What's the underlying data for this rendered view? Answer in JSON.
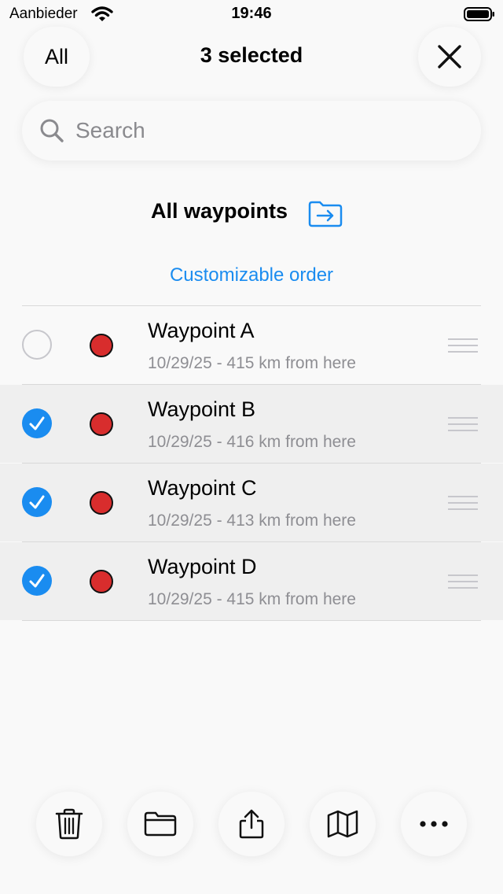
{
  "status_bar": {
    "carrier": "Aanbieder",
    "time": "19:46"
  },
  "nav": {
    "all_label": "All",
    "title": "3 selected"
  },
  "search": {
    "placeholder": "Search",
    "value": ""
  },
  "folder": {
    "title": "All waypoints",
    "order_label": "Customizable order"
  },
  "waypoints": [
    {
      "name": "Waypoint A",
      "subtitle": "10/29/25 - 415 km from here",
      "selected": false,
      "color": "#d82d2d"
    },
    {
      "name": "Waypoint B",
      "subtitle": "10/29/25 - 416 km from here",
      "selected": true,
      "color": "#d82d2d"
    },
    {
      "name": "Waypoint C",
      "subtitle": "10/29/25 - 413 km from here",
      "selected": true,
      "color": "#d82d2d"
    },
    {
      "name": "Waypoint D",
      "subtitle": "10/29/25 - 415 km from here",
      "selected": true,
      "color": "#d82d2d"
    }
  ],
  "toolbar": {
    "icons": [
      "trash-icon",
      "folder-icon",
      "share-icon",
      "map-icon",
      "more-icon"
    ]
  },
  "colors": {
    "accent": "#1a8cf0",
    "waypoint": "#d82d2d",
    "selected_row": "#efefef"
  }
}
